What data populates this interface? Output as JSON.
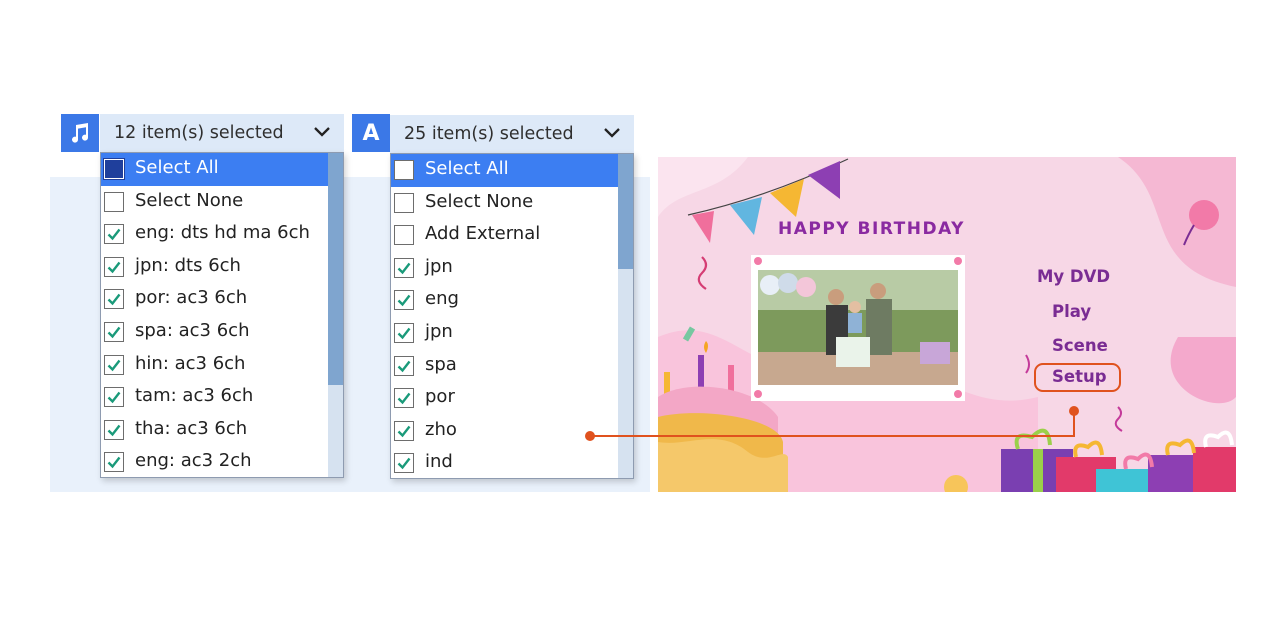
{
  "audio_selector": {
    "icon": "music-note-icon",
    "summary": "12 item(s) selected",
    "items": [
      {
        "label": "Select All",
        "state": "partial",
        "highlighted": true
      },
      {
        "label": "Select None",
        "state": "unchecked"
      },
      {
        "label": "eng: dts hd ma 6ch",
        "state": "checked"
      },
      {
        "label": "jpn: dts 6ch",
        "state": "checked"
      },
      {
        "label": "por: ac3 6ch",
        "state": "checked"
      },
      {
        "label": "spa: ac3 6ch",
        "state": "checked"
      },
      {
        "label": "hin: ac3 6ch",
        "state": "checked"
      },
      {
        "label": "tam: ac3 6ch",
        "state": "checked"
      },
      {
        "label": "tha: ac3 6ch",
        "state": "checked"
      },
      {
        "label": "eng: ac3 2ch",
        "state": "checked"
      }
    ]
  },
  "subtitle_selector": {
    "icon": "letter-a-icon",
    "icon_glyph": "A",
    "summary": "25 item(s) selected",
    "items": [
      {
        "label": "Select All",
        "state": "unchecked",
        "highlighted": true
      },
      {
        "label": "Select None",
        "state": "unchecked"
      },
      {
        "label": "Add External",
        "state": "unchecked"
      },
      {
        "label": "jpn",
        "state": "checked"
      },
      {
        "label": "eng",
        "state": "checked"
      },
      {
        "label": "jpn",
        "state": "checked"
      },
      {
        "label": "spa",
        "state": "checked"
      },
      {
        "label": "por",
        "state": "checked"
      },
      {
        "label": "zho",
        "state": "checked"
      },
      {
        "label": "ind",
        "state": "checked"
      }
    ]
  },
  "dvd_menu": {
    "title": "HAPPY BIRTHDAY",
    "items": [
      "My DVD",
      "Play",
      "Scene",
      "Setup"
    ],
    "highlighted_item": "Setup"
  },
  "colors": {
    "accent_blue": "#3b78e7",
    "highlight_row": "#3c7ef2",
    "check_green": "#1a9a7a",
    "pointer_orange": "#e0521e",
    "menu_purple": "#7a2c93"
  }
}
